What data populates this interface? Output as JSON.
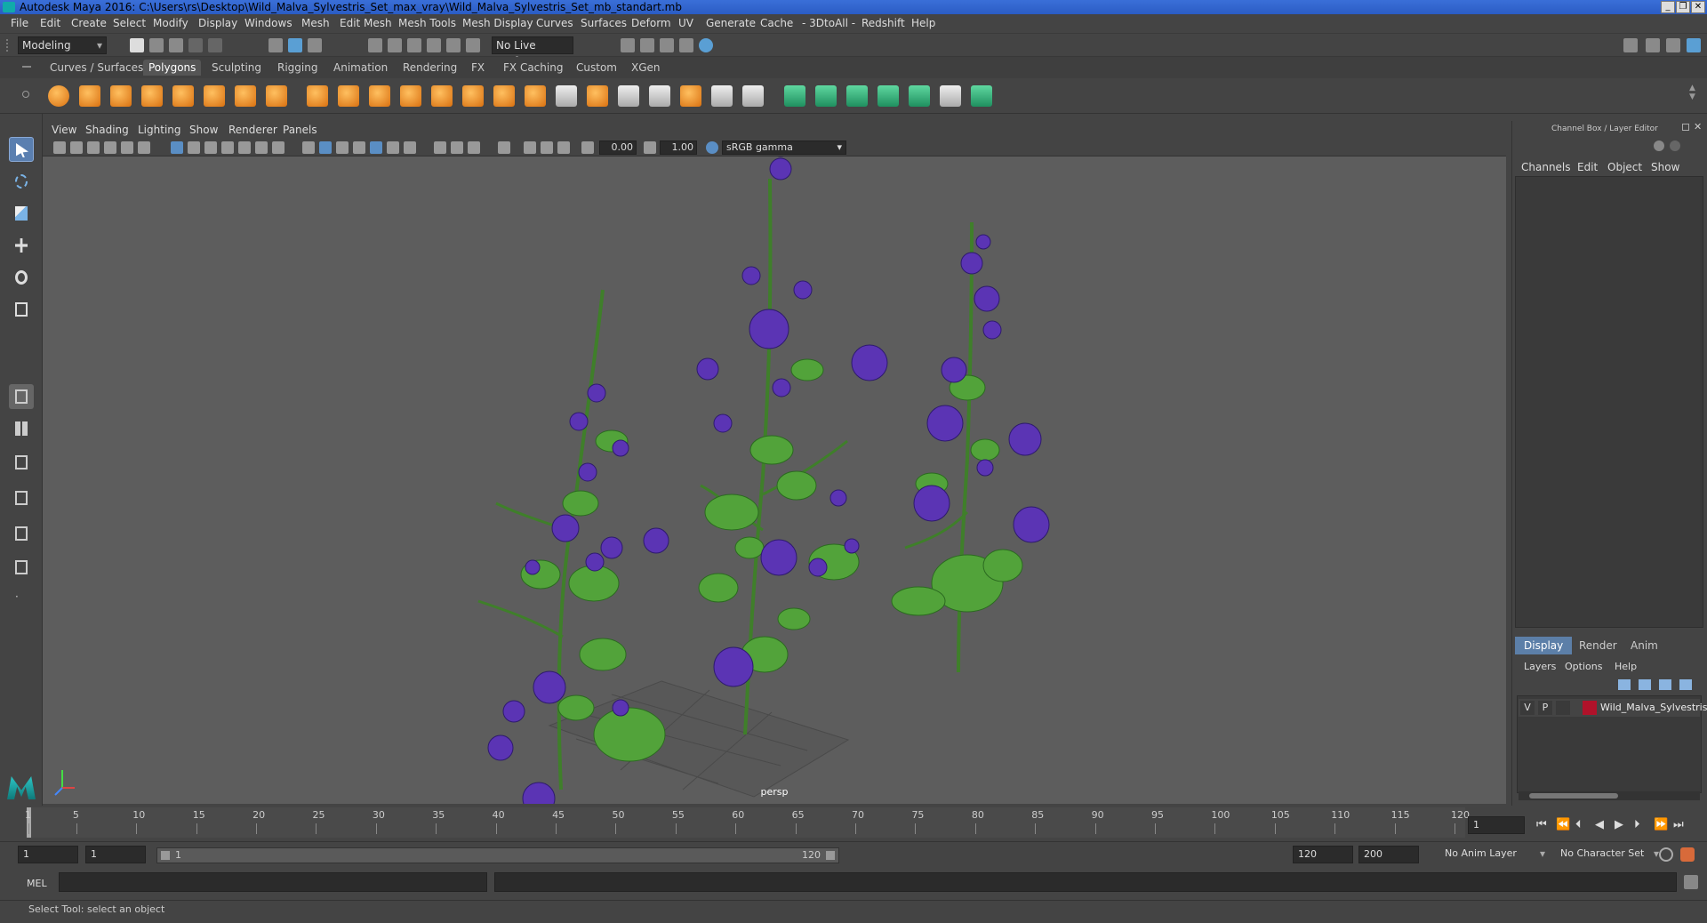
{
  "window": {
    "title": "Autodesk Maya 2016: C:\\Users\\rs\\Desktop\\Wild_Malva_Sylvestris_Set_max_vray\\Wild_Malva_Sylvestris_Set_mb_standart.mb",
    "controls": [
      "minimize-icon",
      "restore-icon",
      "close-icon"
    ]
  },
  "menubar": [
    "File",
    "Edit",
    "Create",
    "Select",
    "Modify",
    "Display",
    "Windows",
    "Mesh",
    "Edit Mesh",
    "Mesh Tools",
    "Mesh Display",
    "Curves",
    "Surfaces",
    "Deform",
    "UV",
    "Generate",
    "Cache",
    "- 3DtoAll -",
    "Redshift",
    "Help"
  ],
  "statusline": {
    "mode": "Modeling",
    "live_surface": "No Live Surface"
  },
  "shelf": {
    "tabs": [
      "Curves / Surfaces",
      "Polygons",
      "Sculpting",
      "Rigging",
      "Animation",
      "Rendering",
      "FX",
      "FX Caching",
      "Custom",
      "XGen"
    ],
    "active_tab": "Polygons"
  },
  "viewport": {
    "menu": [
      "View",
      "Shading",
      "Lighting",
      "Show",
      "Renderer",
      "Panels"
    ],
    "exposure": "0.00",
    "gamma": "1.00",
    "color_space": "sRGB gamma",
    "camera_label": "persp"
  },
  "channel_box": {
    "title": "Channel Box / Layer Editor",
    "menu": [
      "Channels",
      "Edit",
      "Object",
      "Show"
    ]
  },
  "layer_editor": {
    "tabs": [
      "Display",
      "Render",
      "Anim"
    ],
    "active_tab": "Display",
    "menu": [
      "Layers",
      "Options",
      "Help"
    ],
    "layers": [
      {
        "v": "V",
        "p": "P",
        "color": "#b0122a",
        "name": "Wild_Malva_Sylvestris_"
      }
    ]
  },
  "timeline": {
    "ticks": [
      "1",
      "5",
      "10",
      "15",
      "20",
      "25",
      "30",
      "35",
      "40",
      "45",
      "50",
      "55",
      "60",
      "65",
      "70",
      "75",
      "80",
      "85",
      "90",
      "95",
      "100",
      "105",
      "110",
      "115",
      "120"
    ],
    "current_frame": "1"
  },
  "range": {
    "start": "1",
    "anim_start": "1",
    "slider_start": "1",
    "slider_end": "120",
    "anim_end": "120",
    "end": "200",
    "anim_layer": "No Anim Layer",
    "character_set": "No Character Set"
  },
  "command_line": {
    "label": "MEL"
  },
  "help_line": "Select Tool: select an object"
}
